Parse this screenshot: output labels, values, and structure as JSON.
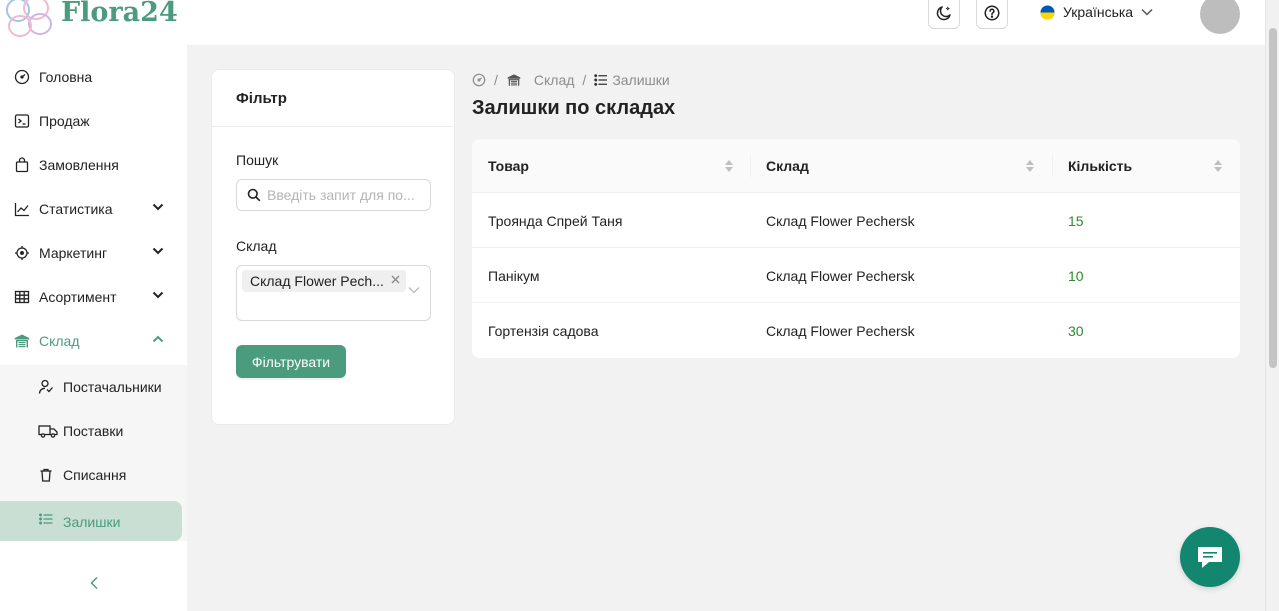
{
  "app": {
    "name": "Flora24"
  },
  "header": {
    "language": "Українська"
  },
  "sidebar": {
    "items": [
      {
        "label": "Головна"
      },
      {
        "label": "Продаж"
      },
      {
        "label": "Замовлення"
      },
      {
        "label": "Статистика"
      },
      {
        "label": "Маркетинг"
      },
      {
        "label": "Асортимент"
      },
      {
        "label": "Склад"
      }
    ],
    "sub_items": [
      {
        "label": "Постачальники"
      },
      {
        "label": "Поставки"
      },
      {
        "label": "Списання"
      },
      {
        "label": "Залишки"
      }
    ]
  },
  "filter": {
    "title": "Фільтр",
    "search_label": "Пошук",
    "search_placeholder": "Введіть запит для по...",
    "warehouse_label": "Склад",
    "warehouse_tag": "Склад Flower Pech...",
    "button": "Фільтрувати"
  },
  "breadcrumb": {
    "warehouse": "Склад",
    "current": "Залишки"
  },
  "page": {
    "title": "Залишки по складах"
  },
  "table": {
    "columns": [
      "Товар",
      "Склад",
      "Кількість"
    ],
    "rows": [
      {
        "product": "Троянда Спрей Таня",
        "warehouse": "Склад Flower Pechersk",
        "qty": "15"
      },
      {
        "product": "Панікум",
        "warehouse": "Склад Flower Pechersk",
        "qty": "10"
      },
      {
        "product": "Гортензія садова",
        "warehouse": "Склад Flower Pechersk",
        "qty": "30"
      }
    ]
  },
  "colors": {
    "accent": "#4b9b7e",
    "quantity": "#2e8b2e",
    "chat": "#13866f",
    "active_bg": "#c9dfd3"
  }
}
